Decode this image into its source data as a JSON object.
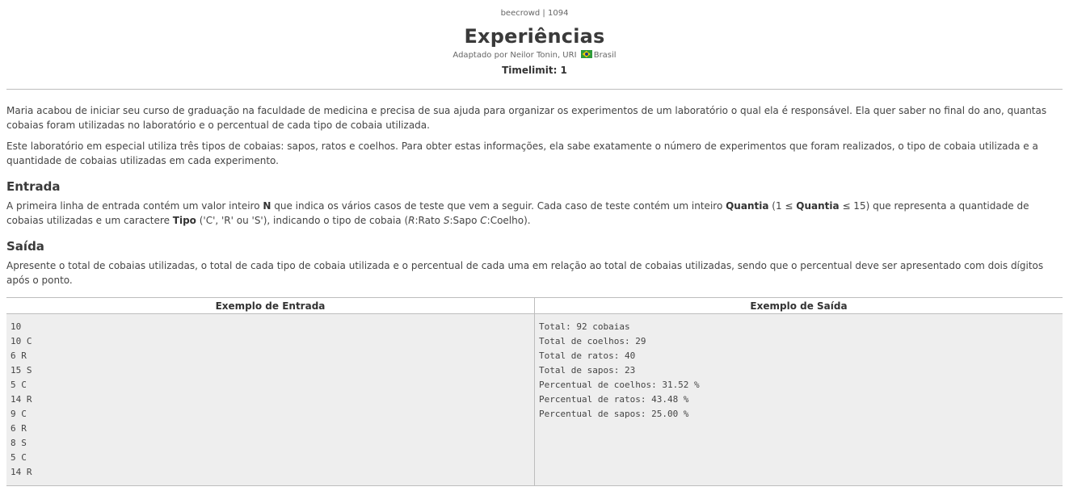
{
  "header": {
    "source": "beecrowd | 1094",
    "title": "Experiências",
    "adapted_prefix": "Adaptado por Neilor Tonin, URI",
    "adapted_country": "Brasil",
    "timelimit": "Timelimit: 1"
  },
  "description": {
    "p1": "Maria acabou de iniciar seu curso de graduação na faculdade de medicina e precisa de sua ajuda para organizar os experimentos de um laboratório o qual ela é responsável. Ela quer saber no final do ano, quantas cobaias foram utilizadas no laboratório e o percentual de cada tipo de cobaia utilizada.",
    "p2": "Este laboratório em especial utiliza três tipos de cobaias: sapos, ratos e coelhos. Para obter estas informações, ela sabe exatamente o número de experimentos que foram realizados, o tipo de cobaia utilizada e a quantidade de cobaias utilizadas em cada experimento."
  },
  "entrada": {
    "heading": "Entrada",
    "t1": "A primeira linha de entrada contém um valor inteiro ",
    "b1": "N",
    "t2": " que indica os vários casos de teste que vem a seguir. Cada caso de teste contém um inteiro ",
    "b2": "Quantia",
    "t3": " (1 ≤ ",
    "b3": "Quantia",
    "t4": " ≤ 15) que representa a quantidade de cobaias utilizadas e um caractere ",
    "b4": "Tipo",
    "t5": " ('C', 'R' ou 'S'), indicando o tipo de cobaia (",
    "i1": "R",
    "t6": ":Rato ",
    "i2": "S",
    "t7": ":Sapo ",
    "i3": "C",
    "t8": ":Coelho)."
  },
  "saida": {
    "heading": "Saída",
    "text": "Apresente o total de cobaias utilizadas, o total de cada tipo de cobaia utilizada e o percentual de cada uma em relação ao total de cobaias utilizadas, sendo que o percentual deve ser apresentado com dois dígitos após o ponto."
  },
  "examples": {
    "input_header": "Exemplo de Entrada",
    "output_header": "Exemplo de Saída",
    "input_lines": [
      "10",
      "10 C",
      "6 R",
      "15 S",
      "5 C",
      "14 R",
      "9 C",
      "6 R",
      "8 S",
      "5 C",
      "14 R"
    ],
    "output_lines": [
      "Total: 92 cobaias",
      "Total de coelhos: 29",
      "Total de ratos: 40",
      "Total de sapos: 23",
      "Percentual de coelhos: 31.52 %",
      "Percentual de ratos: 43.48 %",
      "Percentual de sapos: 25.00 %"
    ]
  },
  "colors": {
    "text": "#444444",
    "example_bg": "#eeeeee",
    "rule": "#bdbdbd"
  },
  "icons": {
    "flag": "brazil-flag-icon"
  }
}
